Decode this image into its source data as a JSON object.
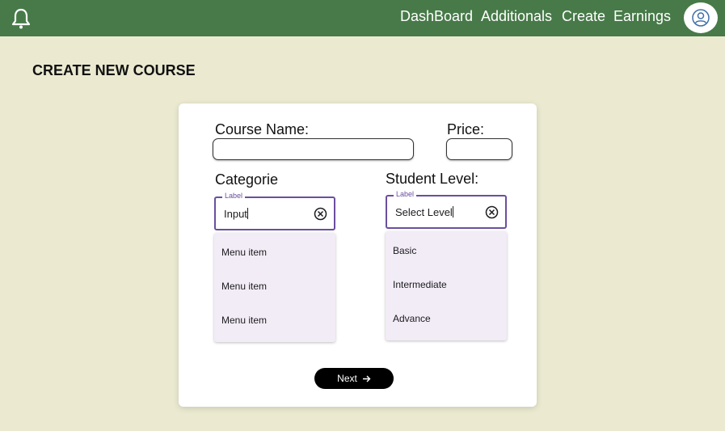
{
  "topbar": {
    "nav": [
      "DashBoard",
      "Additionals",
      "Create",
      "Earnings"
    ],
    "color": "#477a48",
    "icons": [
      "bell-icon",
      "user-avatar-icon"
    ]
  },
  "page": {
    "title": "CREATE NEW COURSE"
  },
  "form": {
    "course_name": {
      "label": "Course Name:",
      "value": ""
    },
    "price": {
      "label": "Price:",
      "value": ""
    },
    "category": {
      "label": "Categorie",
      "field_label": "Label",
      "value": "Input",
      "menu": [
        "Menu item",
        "Menu item",
        "Menu item"
      ]
    },
    "student_level": {
      "label": "Student Level:",
      "field_label": "Label",
      "value": "Select Level",
      "menu": [
        "Basic",
        "Intermediate",
        "Advance"
      ]
    },
    "next_label": "Next",
    "accent": "#6b4e9e"
  }
}
